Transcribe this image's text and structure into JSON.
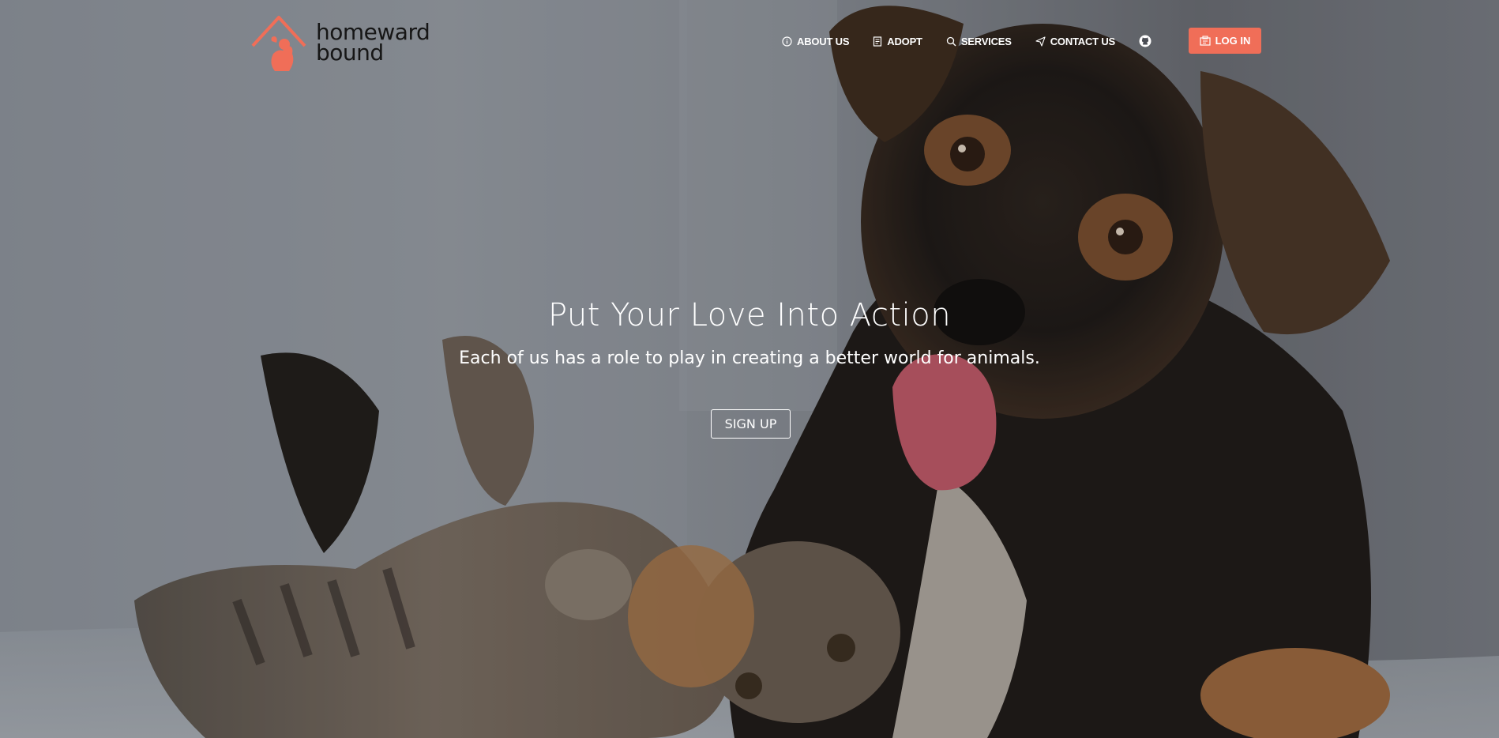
{
  "brand": {
    "line1": "homeward",
    "line2": "bound",
    "accent": "#f06e58"
  },
  "nav": {
    "items": [
      {
        "label": "ABOUT US",
        "icon": "info-icon"
      },
      {
        "label": "ADOPT",
        "icon": "document-icon"
      },
      {
        "label": "SERVICES",
        "icon": "search-icon"
      },
      {
        "label": "CONTACT US",
        "icon": "send-icon"
      }
    ],
    "github_icon": "github-icon",
    "login_label": "LOG IN",
    "login_icon": "login-icon"
  },
  "hero": {
    "headline": "Put Your Love Into Action",
    "subhead": "Each of us has a role to play in creating a better world for animals.",
    "cta_label": "SIGN UP",
    "image": "photo of a puppy and a tabby kitten playing"
  }
}
